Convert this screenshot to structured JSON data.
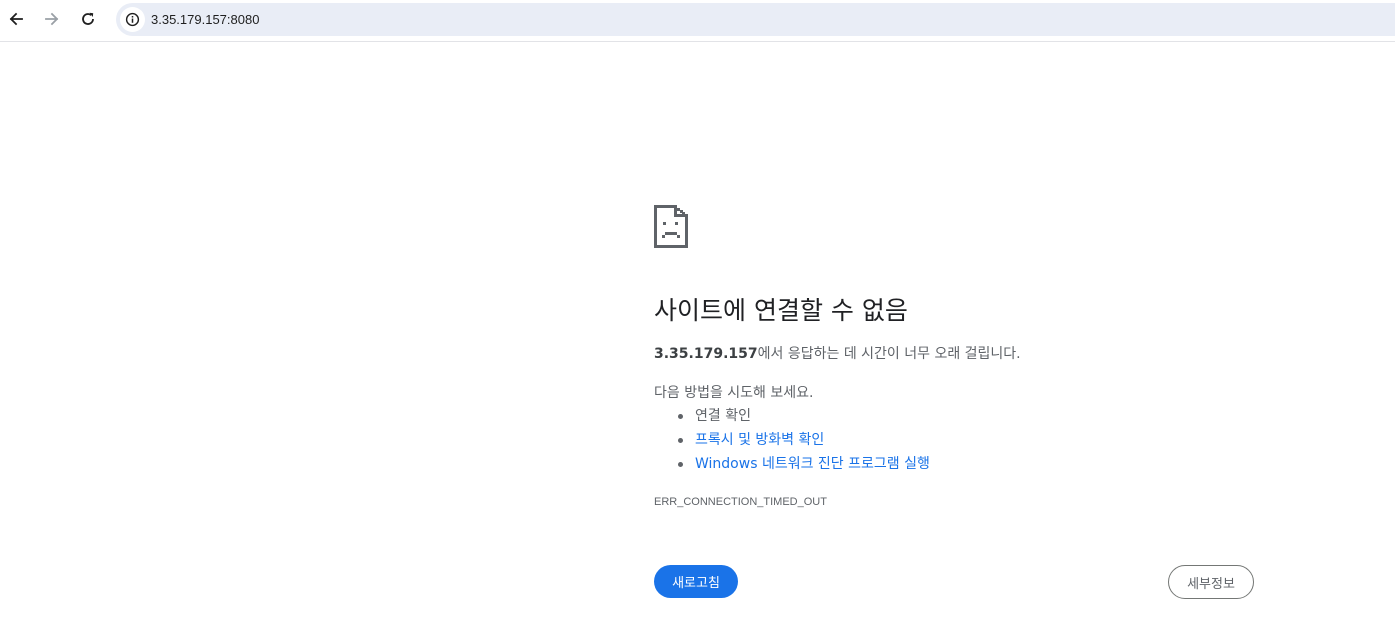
{
  "toolbar": {
    "back_icon": "arrow-left-icon",
    "forward_icon": "arrow-right-icon",
    "reload_icon": "reload-icon",
    "site_info_icon": "info-icon",
    "url": "3.35.179.157:8080"
  },
  "error_page": {
    "icon": "sad-page-icon",
    "heading": "사이트에 연결할 수 없음",
    "host": "3.35.179.157",
    "description_suffix": "에서 응답하는 데 시간이 너무 오래 걸립니다.",
    "try_label": "다음 방법을 시도해 보세요.",
    "suggestions": [
      {
        "label": "연결 확인",
        "link": false
      },
      {
        "label": "프록시 및 방화벽 확인",
        "link": true
      },
      {
        "label": "Windows 네트워크 진단 프로그램 실행",
        "link": true
      }
    ],
    "error_code": "ERR_CONNECTION_TIMED_OUT",
    "reload_button": "새로고침",
    "details_button": "세부정보"
  },
  "colors": {
    "accent": "#1a73e8",
    "text_primary": "#202124",
    "text_secondary": "#5f6368",
    "omnibox_bg": "#e9edf6"
  }
}
